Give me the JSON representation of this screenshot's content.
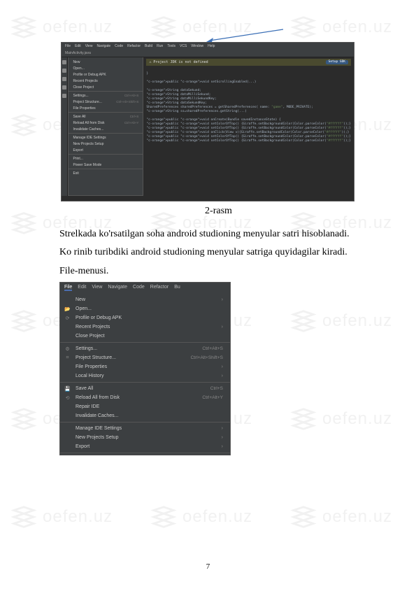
{
  "watermark_text": "oefen.uz",
  "arrow_color": "#3b6fb6",
  "ide": {
    "menubar": [
      "File",
      "Edit",
      "View",
      "Navigate",
      "Code",
      "Refactor",
      "Build",
      "Run",
      "Tools",
      "VCS",
      "Window",
      "Help"
    ],
    "tab_label": "MainActivity.java",
    "banner_text": "Project JDK is not defined",
    "banner_action": "Setup SDK",
    "dropdown": [
      {
        "label": "New",
        "key": ""
      },
      {
        "label": "Open...",
        "key": ""
      },
      {
        "label": "Profile or Debug APK",
        "key": ""
      },
      {
        "label": "Recent Projects",
        "key": ""
      },
      {
        "label": "Close Project",
        "key": ""
      },
      {
        "sep": true
      },
      {
        "label": "Settings...",
        "key": "Ctrl+Alt+S"
      },
      {
        "label": "Project Structure...",
        "key": "Ctrl+Alt+Shift+S"
      },
      {
        "label": "File Properties",
        "key": ""
      },
      {
        "sep": true
      },
      {
        "label": "Save All",
        "key": "Ctrl+S"
      },
      {
        "label": "Reload All from Disk",
        "key": "Ctrl+Alt+Y"
      },
      {
        "label": "Invalidate Caches...",
        "key": ""
      },
      {
        "sep": true
      },
      {
        "label": "Manage IDE Settings",
        "key": ""
      },
      {
        "label": "New Projects Setup",
        "key": ""
      },
      {
        "label": "Export",
        "key": ""
      },
      {
        "sep": true
      },
      {
        "label": "Print...",
        "key": ""
      },
      {
        "label": "Power Save Mode",
        "key": ""
      },
      {
        "sep": true
      },
      {
        "label": "Exit",
        "key": ""
      }
    ],
    "code_lines": [
      "",
      "}",
      "",
      "public void setScrollingEnabled(...)",
      "",
      "    String dataSekund;",
      "    String dataMilliSekund;",
      "    String dataMilliSekundKey;",
      "    String dataSekundKey;",
      "    SharedPreferences sharedPreferences = getSharedPreferences( name: \"game\", MODE_PRIVATE);",
      "    String ss=sharedPreferences.getString(...)",
      "",
      "    public void onCreate(Bundle savedInstanceState) {",
      "        public void setColorOfTop() {Giraffe.setBackgroundColor(Color.parseColor(\"#ffffff\"));}",
      "        public void setColorOfTop() {Giraffe.setBackgroundColor(Color.parseColor(\"#ffffff\"));}",
      "        public void onClick(View v){Giraffe.setBackgroundColor(Color.parseColor(\"#ffffff\"));}",
      "        public void setColorOfTop() {Giraffe.setBackgroundColor(Color.parseColor(\"#ffffff\"));}",
      "        public void setColorOfTop() {Giraffe.setBackgroundColor(Color.parseColor(\"#ffffff\"));}"
    ]
  },
  "caption_1": "2-rasm",
  "paragraph_1": "Strelkada ko'rsatilgan soha android studioning menyular satri hisoblanadi.",
  "paragraph_2": "Ko rinib turibdiki android studioning menyular satriga quyidagilar kiradi.",
  "paragraph_3": "File-menusi.",
  "file_menu": {
    "tabs": [
      "File",
      "Edit",
      "View",
      "Navigate",
      "Code",
      "Refactor",
      "Bu"
    ],
    "items": [
      {
        "icon": "",
        "label": "New",
        "right": "›"
      },
      {
        "icon": "📂",
        "label": "Open...",
        "right": ""
      },
      {
        "icon": "⟳",
        "label": "Profile or Debug APK",
        "right": ""
      },
      {
        "icon": "",
        "label": "Recent Projects",
        "right": "›"
      },
      {
        "icon": "",
        "label": "Close Project",
        "right": ""
      },
      {
        "sep": true
      },
      {
        "icon": "⚙",
        "label": "Settings...",
        "right": "Ctrl+Alt+S"
      },
      {
        "icon": "⌗",
        "label": "Project Structure...",
        "right": "Ctrl+Alt+Shift+S"
      },
      {
        "icon": "",
        "label": "File Properties",
        "right": "›"
      },
      {
        "icon": "",
        "label": "Local History",
        "right": "›"
      },
      {
        "sep": true
      },
      {
        "icon": "💾",
        "label": "Save All",
        "right": "Ctrl+S"
      },
      {
        "icon": "⟲",
        "label": "Reload All from Disk",
        "right": "Ctrl+Alt+Y"
      },
      {
        "icon": "",
        "label": "Repair IDE",
        "right": ""
      },
      {
        "icon": "",
        "label": "Invalidate Caches...",
        "right": ""
      },
      {
        "sep": true
      },
      {
        "icon": "",
        "label": "Manage IDE Settings",
        "right": "›"
      },
      {
        "icon": "",
        "label": "New Projects Setup",
        "right": "›"
      },
      {
        "icon": "",
        "label": "Export",
        "right": "›"
      },
      {
        "sep": true
      },
      {
        "icon": "🖶",
        "label": "Print...",
        "right": ""
      },
      {
        "icon": "",
        "label": "Power Save Mode",
        "right": ""
      },
      {
        "sep": true
      },
      {
        "icon": "",
        "label": "Exit",
        "right": ""
      }
    ]
  },
  "page_number": "7"
}
